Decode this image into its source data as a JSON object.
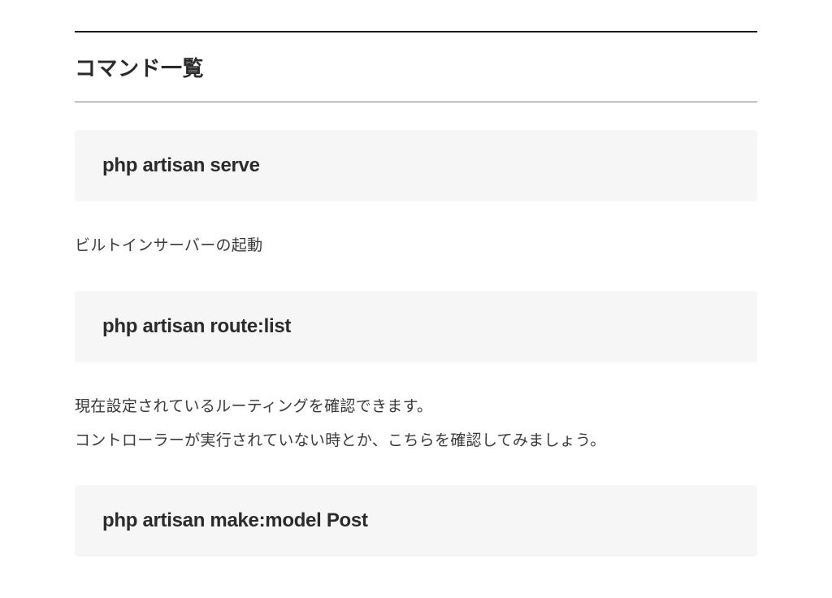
{
  "section": {
    "title": "コマンド一覧"
  },
  "commands": [
    {
      "code": "php artisan serve",
      "description": "ビルトインサーバーの起動"
    },
    {
      "code": "php artisan route:list",
      "description": "現在設定されているルーティングを確認できます。\nコントローラーが実行されていない時とか、こちらを確認してみましょう。"
    },
    {
      "code": "php artisan make:model Post",
      "description": ""
    }
  ]
}
